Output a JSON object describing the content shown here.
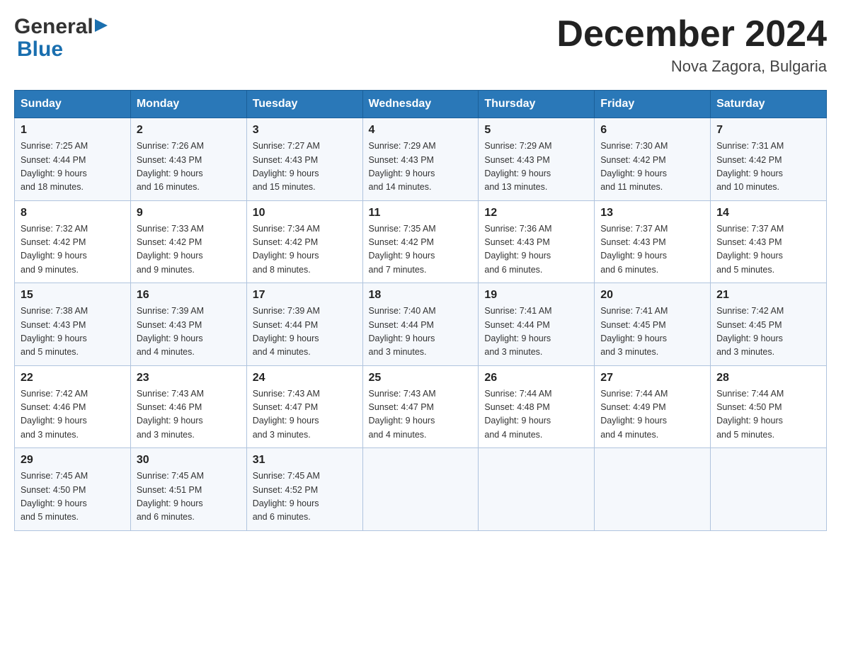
{
  "header": {
    "logo_line1": "General",
    "logo_line2": "Blue",
    "title": "December 2024",
    "subtitle": "Nova Zagora, Bulgaria"
  },
  "days_of_week": [
    "Sunday",
    "Monday",
    "Tuesday",
    "Wednesday",
    "Thursday",
    "Friday",
    "Saturday"
  ],
  "weeks": [
    [
      {
        "day": "1",
        "sunrise": "7:25 AM",
        "sunset": "4:44 PM",
        "daylight": "9 hours and 18 minutes."
      },
      {
        "day": "2",
        "sunrise": "7:26 AM",
        "sunset": "4:43 PM",
        "daylight": "9 hours and 16 minutes."
      },
      {
        "day": "3",
        "sunrise": "7:27 AM",
        "sunset": "4:43 PM",
        "daylight": "9 hours and 15 minutes."
      },
      {
        "day": "4",
        "sunrise": "7:29 AM",
        "sunset": "4:43 PM",
        "daylight": "9 hours and 14 minutes."
      },
      {
        "day": "5",
        "sunrise": "7:29 AM",
        "sunset": "4:43 PM",
        "daylight": "9 hours and 13 minutes."
      },
      {
        "day": "6",
        "sunrise": "7:30 AM",
        "sunset": "4:42 PM",
        "daylight": "9 hours and 11 minutes."
      },
      {
        "day": "7",
        "sunrise": "7:31 AM",
        "sunset": "4:42 PM",
        "daylight": "9 hours and 10 minutes."
      }
    ],
    [
      {
        "day": "8",
        "sunrise": "7:32 AM",
        "sunset": "4:42 PM",
        "daylight": "9 hours and 9 minutes."
      },
      {
        "day": "9",
        "sunrise": "7:33 AM",
        "sunset": "4:42 PM",
        "daylight": "9 hours and 9 minutes."
      },
      {
        "day": "10",
        "sunrise": "7:34 AM",
        "sunset": "4:42 PM",
        "daylight": "9 hours and 8 minutes."
      },
      {
        "day": "11",
        "sunrise": "7:35 AM",
        "sunset": "4:42 PM",
        "daylight": "9 hours and 7 minutes."
      },
      {
        "day": "12",
        "sunrise": "7:36 AM",
        "sunset": "4:43 PM",
        "daylight": "9 hours and 6 minutes."
      },
      {
        "day": "13",
        "sunrise": "7:37 AM",
        "sunset": "4:43 PM",
        "daylight": "9 hours and 6 minutes."
      },
      {
        "day": "14",
        "sunrise": "7:37 AM",
        "sunset": "4:43 PM",
        "daylight": "9 hours and 5 minutes."
      }
    ],
    [
      {
        "day": "15",
        "sunrise": "7:38 AM",
        "sunset": "4:43 PM",
        "daylight": "9 hours and 5 minutes."
      },
      {
        "day": "16",
        "sunrise": "7:39 AM",
        "sunset": "4:43 PM",
        "daylight": "9 hours and 4 minutes."
      },
      {
        "day": "17",
        "sunrise": "7:39 AM",
        "sunset": "4:44 PM",
        "daylight": "9 hours and 4 minutes."
      },
      {
        "day": "18",
        "sunrise": "7:40 AM",
        "sunset": "4:44 PM",
        "daylight": "9 hours and 3 minutes."
      },
      {
        "day": "19",
        "sunrise": "7:41 AM",
        "sunset": "4:44 PM",
        "daylight": "9 hours and 3 minutes."
      },
      {
        "day": "20",
        "sunrise": "7:41 AM",
        "sunset": "4:45 PM",
        "daylight": "9 hours and 3 minutes."
      },
      {
        "day": "21",
        "sunrise": "7:42 AM",
        "sunset": "4:45 PM",
        "daylight": "9 hours and 3 minutes."
      }
    ],
    [
      {
        "day": "22",
        "sunrise": "7:42 AM",
        "sunset": "4:46 PM",
        "daylight": "9 hours and 3 minutes."
      },
      {
        "day": "23",
        "sunrise": "7:43 AM",
        "sunset": "4:46 PM",
        "daylight": "9 hours and 3 minutes."
      },
      {
        "day": "24",
        "sunrise": "7:43 AM",
        "sunset": "4:47 PM",
        "daylight": "9 hours and 3 minutes."
      },
      {
        "day": "25",
        "sunrise": "7:43 AM",
        "sunset": "4:47 PM",
        "daylight": "9 hours and 4 minutes."
      },
      {
        "day": "26",
        "sunrise": "7:44 AM",
        "sunset": "4:48 PM",
        "daylight": "9 hours and 4 minutes."
      },
      {
        "day": "27",
        "sunrise": "7:44 AM",
        "sunset": "4:49 PM",
        "daylight": "9 hours and 4 minutes."
      },
      {
        "day": "28",
        "sunrise": "7:44 AM",
        "sunset": "4:50 PM",
        "daylight": "9 hours and 5 minutes."
      }
    ],
    [
      {
        "day": "29",
        "sunrise": "7:45 AM",
        "sunset": "4:50 PM",
        "daylight": "9 hours and 5 minutes."
      },
      {
        "day": "30",
        "sunrise": "7:45 AM",
        "sunset": "4:51 PM",
        "daylight": "9 hours and 6 minutes."
      },
      {
        "day": "31",
        "sunrise": "7:45 AM",
        "sunset": "4:52 PM",
        "daylight": "9 hours and 6 minutes."
      },
      null,
      null,
      null,
      null
    ]
  ],
  "labels": {
    "sunrise": "Sunrise:",
    "sunset": "Sunset:",
    "daylight": "Daylight:"
  }
}
